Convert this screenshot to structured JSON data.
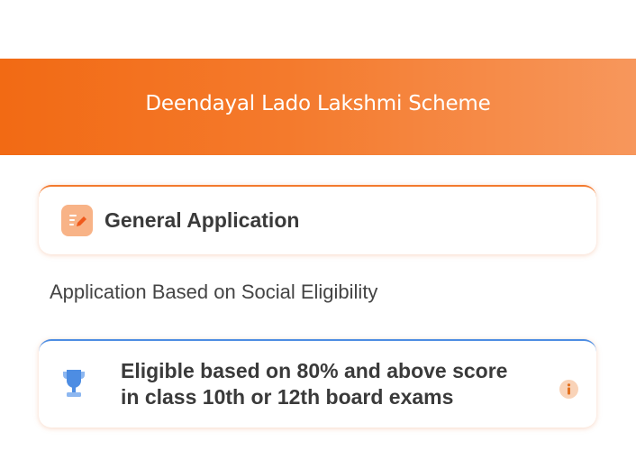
{
  "header": {
    "title": "Deendayal Lado Lakshmi Scheme"
  },
  "general_card": {
    "icon": "edit-document-icon",
    "label": "General Application"
  },
  "subtitle": "Application Based on Social Eligibility",
  "eligibility_card": {
    "icon": "trophy-icon",
    "line1": "Eligible based on 80% and above score",
    "line2": "in class 10th or 12th board exams",
    "info_icon": "info-icon"
  },
  "colors": {
    "header_gradient_start": "#f26a14",
    "header_gradient_end": "#f7975c",
    "general_accent": "#f37a2e",
    "eligibility_accent": "#4d8de3"
  }
}
